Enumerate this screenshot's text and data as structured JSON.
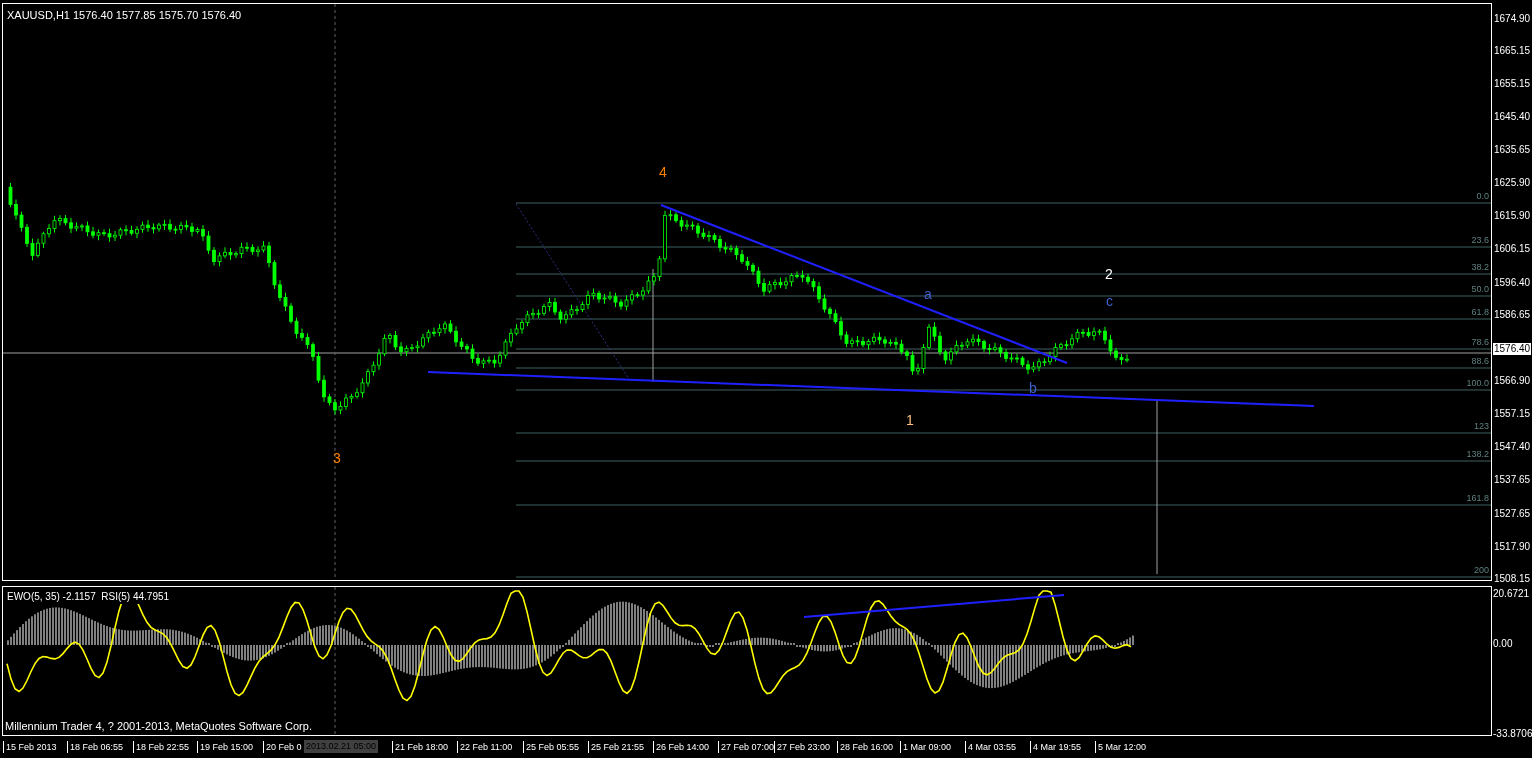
{
  "header": {
    "symbol": "XAUUSD,H1",
    "quote": "1576.40 1577.85 1575.70 1576.40"
  },
  "price_axis": [
    "1674.90",
    "1665.15",
    "1655.15",
    "1645.40",
    "1635.65",
    "1625.90",
    "1615.90",
    "1606.15",
    "1596.40",
    "1586.65",
    "1566.90",
    "1557.15",
    "1547.40",
    "1537.65",
    "1527.65",
    "1517.90",
    "1508.15"
  ],
  "current_price": "1576.40",
  "fib_levels": [
    "0.0",
    "23.6",
    "38.2",
    "50.0",
    "61.8",
    "78.6",
    "88.6",
    "100.0",
    "123",
    "138.2",
    "161.8",
    "200"
  ],
  "wave_labels": [
    {
      "text": "4",
      "color": "#ff8000"
    },
    {
      "text": "3",
      "color": "#ff8000"
    },
    {
      "text": "a",
      "color": "#4060d0"
    },
    {
      "text": "1",
      "color": "#ffc080"
    },
    {
      "text": "b",
      "color": "#4060d0"
    },
    {
      "text": "2",
      "color": "#ffffff"
    },
    {
      "text": "c",
      "color": "#4060d0"
    }
  ],
  "indicator": {
    "title": "EWO(5, 35) -2.1157  RSI(5) 44.7951",
    "axis": [
      "20.6721",
      "0.00",
      "-33.8706"
    ]
  },
  "copyright": "Millennium Trader 4, ? 2001-2013, MetaQuotes Software Corp.",
  "time_axis": [
    "15 Feb 2013",
    "18 Feb 06:55",
    "18 Feb 22:55",
    "19 Feb 15:00",
    "20 Feb 0",
    "21 Feb 18:00",
    "22 Feb 11:00",
    "25 Feb 05:55",
    "25 Feb 21:55",
    "26 Feb 14:00",
    "27 Feb 07:00",
    "27 Feb 23:00",
    "28 Feb 16:00",
    "1 Mar 09:00",
    "4 Mar 03:55",
    "4 Mar 19:55",
    "5 Mar 12:00"
  ],
  "crosshair_time": "2013.02.21 05:00"
}
